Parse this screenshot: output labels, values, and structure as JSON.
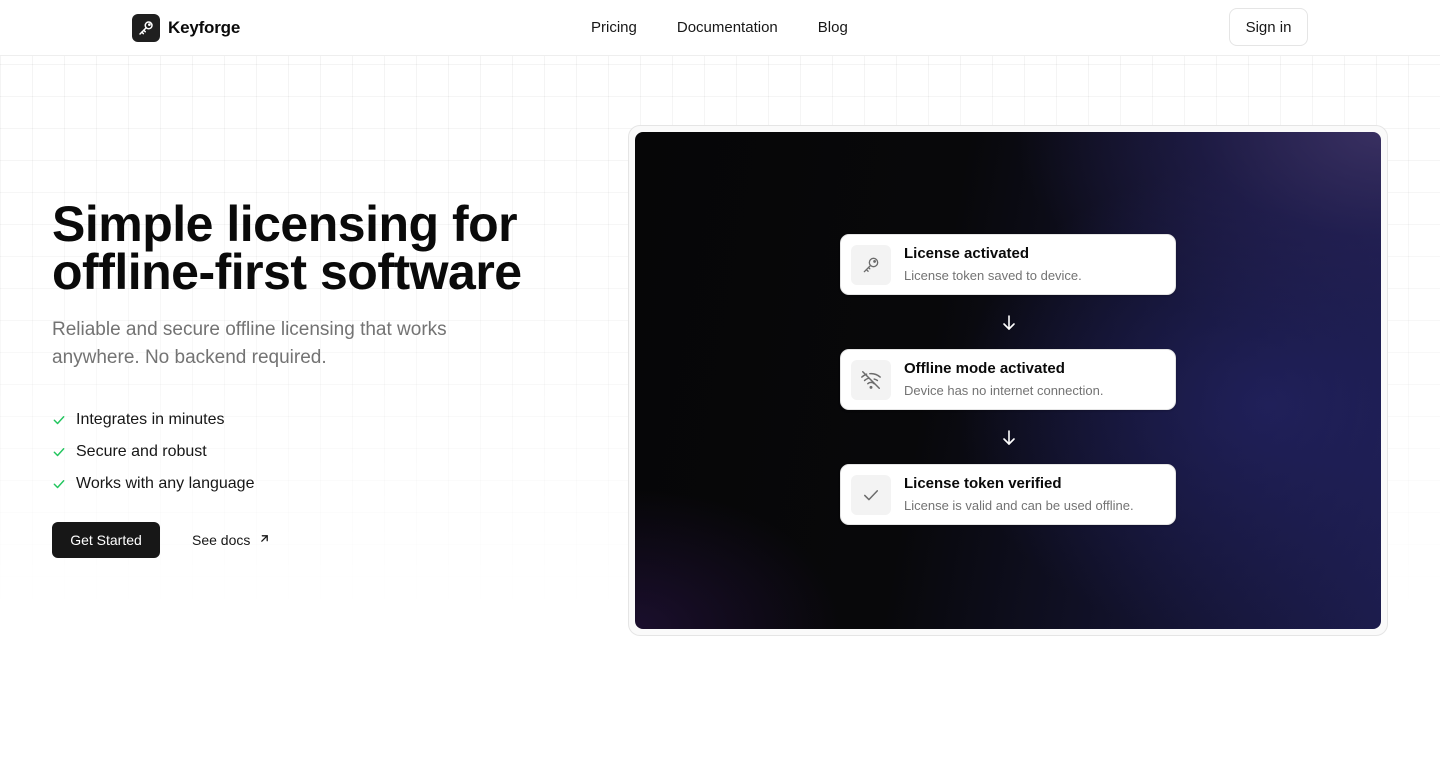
{
  "brand": {
    "name": "Keyforge",
    "logo_icon": "key-icon"
  },
  "nav": {
    "links": [
      {
        "label": "Pricing"
      },
      {
        "label": "Documentation"
      },
      {
        "label": "Blog"
      }
    ],
    "signin_label": "Sign in"
  },
  "hero": {
    "title_line1": "Simple licensing for",
    "title_line2": "offline-first software",
    "subtitle": "Reliable and secure offline licensing that works anywhere. No backend required.",
    "features": [
      {
        "label": "Integrates in minutes",
        "icon": "check-icon"
      },
      {
        "label": "Secure and robust",
        "icon": "check-icon"
      },
      {
        "label": "Works with any language",
        "icon": "check-icon"
      }
    ],
    "primary_cta": "Get Started",
    "secondary_cta": "See docs",
    "secondary_icon": "arrow-up-right-icon"
  },
  "preview": {
    "steps": [
      {
        "title": "License activated",
        "description": "License token saved to device.",
        "icon": "key-icon"
      },
      {
        "title": "Offline mode activated",
        "description": "Device has no internet connection.",
        "icon": "wifi-off-icon"
      },
      {
        "title": "License token verified",
        "description": "License is valid and can be used offline.",
        "icon": "check-icon"
      }
    ],
    "connector_icon": "arrow-down-icon"
  },
  "colors": {
    "primary_button": "#171717",
    "check_green": "#22c55e",
    "muted_text": "#737373"
  }
}
